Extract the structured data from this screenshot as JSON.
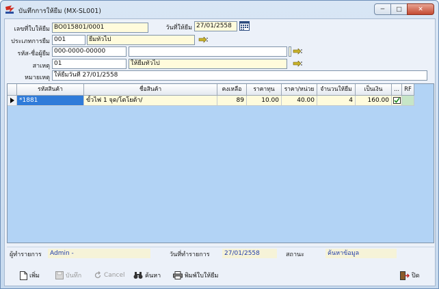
{
  "window": {
    "title": "บันทึกการให้ยืม (MX-SL001)",
    "buttons": [
      "─",
      "□",
      "✕"
    ]
  },
  "form": {
    "doc_no_label": "เลขที่ใบให้ยืม",
    "doc_no_value": "BO015801/0001",
    "date_label": "วันที่ให้ยืม",
    "date_value": "27/01/2558",
    "borrow_type_label": "ประเภทการยืม",
    "borrow_type_code": "001",
    "borrow_type_name": "ยืมทั่วไป",
    "borrower_label": "รหัส-ชื่อผู้ยืม",
    "borrower_code": "000-0000-00000",
    "borrower_name": "",
    "borrower_extra": "",
    "reason_label": "สาเหตุ",
    "reason_code": "01",
    "reason_name": "ให้ยืมทั่วไป",
    "note_label": "หมายเหตุ",
    "note_value": "ให้ยืมวันที่ 27/01/2558"
  },
  "grid": {
    "columns": [
      "รหัสสินค้า",
      "ชื่อสินค้า",
      "คงเหลือ",
      "ราคาทุน",
      "ราคา/หน่วย",
      "จำนวนให้ยืม",
      "เป็นเงิน",
      "...",
      "RF"
    ],
    "rows": [
      {
        "code": "*1881",
        "name": "ขั้วไฟ 1 จุด/โตโยต้า/",
        "balance": "89",
        "cost": "10.00",
        "unit_price": "40.00",
        "qty": "4",
        "amount": "160.00"
      }
    ]
  },
  "status": {
    "operator_label": "ผู้ทำรายการ",
    "operator_value": "Admin -",
    "txn_date_label": "วันที่ทำรายการ",
    "txn_date_value": "27/01/2558",
    "state_label": "สถานะ",
    "state_value": "ค้นหาข้อมูล"
  },
  "toolbar": {
    "add": "เพิ่ม",
    "save": "บันทึก",
    "cancel": "Cancel",
    "search": "ค้นหา",
    "print": "พิมพ์ใบให้ยืม",
    "exit": "ปิด"
  },
  "colors": {
    "grid_bg": "#b2d3f5",
    "field_yellow": "#fffbdc",
    "selected_cell": "#2f7bd9",
    "status_value_text": "#1f3ba8"
  }
}
